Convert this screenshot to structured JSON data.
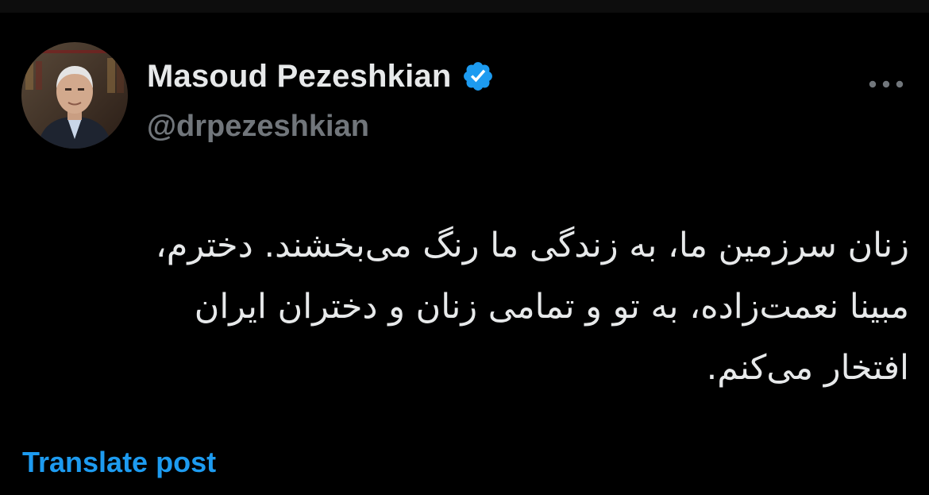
{
  "post": {
    "author": {
      "display_name": "Masoud Pezeshkian",
      "handle": "@drpezeshkian",
      "verified": true,
      "verified_icon": "verified-badge-icon",
      "avatar_icon": "profile-photo"
    },
    "more_icon": "more-horizontal-icon",
    "text_lines": [
      "زنان سرزمین ما، به زندگی ما رنگ می‌بخشند. دخترم،",
      "مبینا نعمت‌زاده، به تو و تمامی زنان و دختران ایران",
      "افتخار می‌کنم."
    ],
    "translate_label": "Translate post"
  },
  "colors": {
    "background": "#000000",
    "text_primary": "#e7e9ea",
    "text_secondary": "#71767b",
    "accent": "#1d9bf0"
  }
}
